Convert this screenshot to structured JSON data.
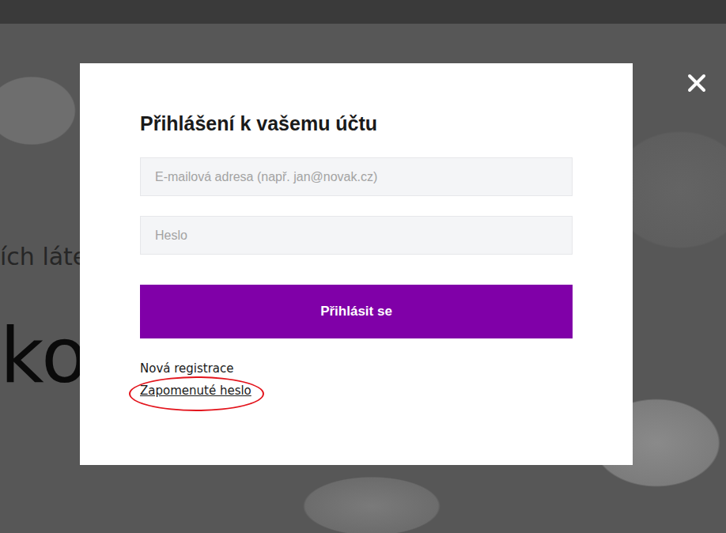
{
  "background": {
    "texts": [
      {
        "text": "ích láte",
        "kind": "subtitle"
      },
      {
        "text": "ko",
        "kind": "headline"
      }
    ]
  },
  "modal": {
    "title": "Přihlášení k vašemu účtu",
    "fields": [
      {
        "placeholder": "E-mailová adresa (např. jan@novak.cz)",
        "kind": "email"
      },
      {
        "placeholder": "Heslo",
        "kind": "password"
      }
    ],
    "submit": "Přihlásit se",
    "links": [
      {
        "label": "Nová registrace",
        "underlined": false,
        "highlighted": false
      },
      {
        "label": "Zapomenuté heslo",
        "underlined": true,
        "highlighted": true
      }
    ]
  }
}
